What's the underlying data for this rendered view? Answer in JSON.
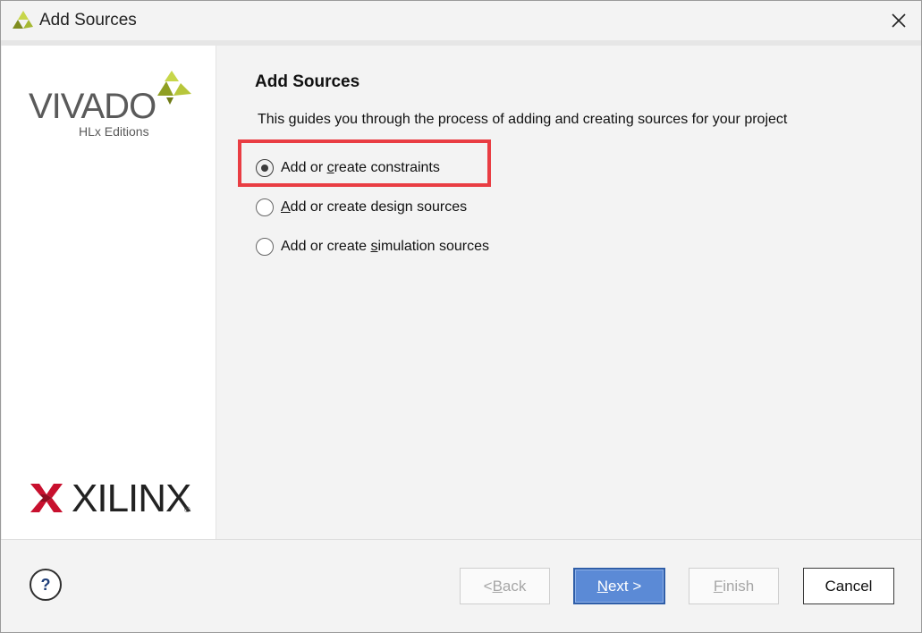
{
  "window": {
    "title": "Add Sources"
  },
  "sidebar": {
    "vivado_logo": "VIVADO",
    "vivado_edition": "HLx Editions",
    "xilinx_logo": "XILINX",
    "xilinx_registered": "®"
  },
  "main": {
    "heading": "Add Sources",
    "description": "This guides you through the process of adding and creating sources for your project",
    "options": [
      {
        "pre": "Add or ",
        "mnemonic": "c",
        "post": "reate constraints",
        "selected": true
      },
      {
        "pre": "",
        "mnemonic": "A",
        "post": "dd or create design sources",
        "selected": false
      },
      {
        "pre": "Add or create ",
        "mnemonic": "s",
        "post": "imulation sources",
        "selected": false
      }
    ],
    "highlight_color": "#e93d43"
  },
  "footer": {
    "help_label": "?",
    "back": {
      "pre": "< ",
      "mnemonic": "B",
      "post": "ack",
      "enabled": false
    },
    "next": {
      "pre": "",
      "mnemonic": "N",
      "post": "ext >",
      "enabled": true
    },
    "finish": {
      "pre": "",
      "mnemonic": "F",
      "post": "inish",
      "enabled": false
    },
    "cancel": {
      "label": "Cancel",
      "enabled": true
    }
  },
  "colors": {
    "accent": "#5b8ad6",
    "vivado_green": "#a5b832",
    "xilinx_red": "#c8102e"
  }
}
